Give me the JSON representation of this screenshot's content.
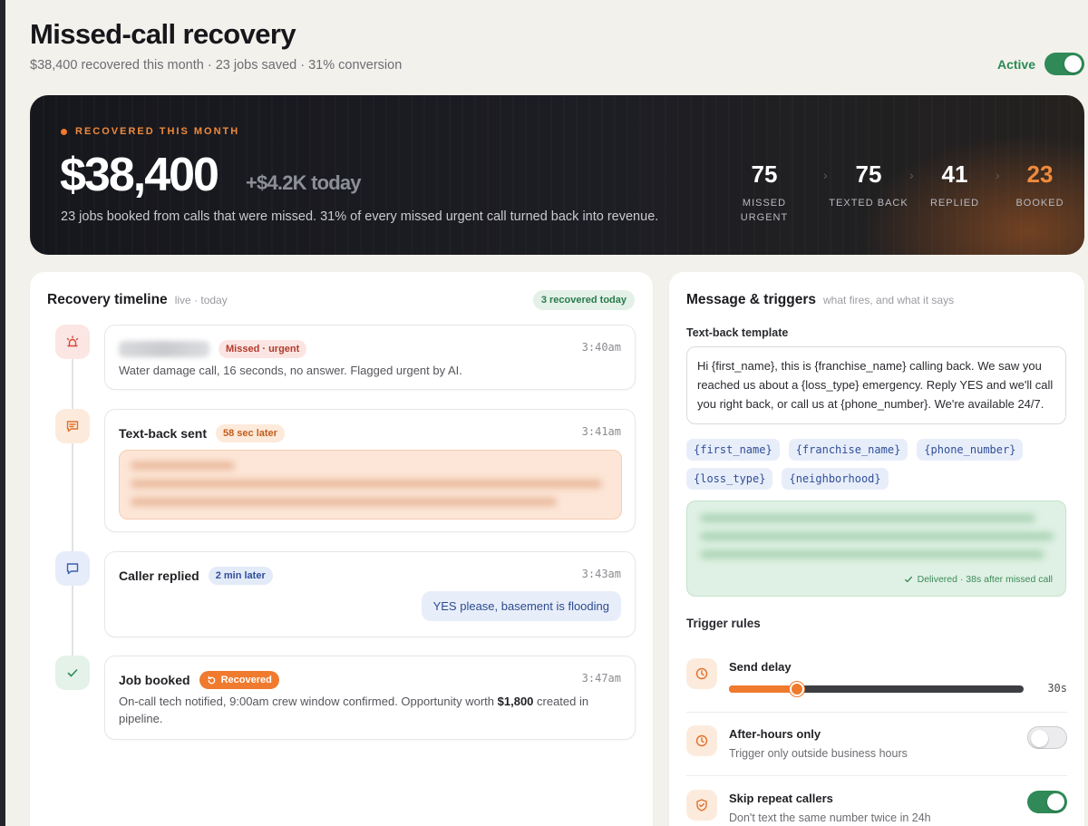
{
  "header": {
    "title": "Missed-call recovery",
    "subtitle": "$38,400 recovered this month · 23 jobs saved · 31% conversion",
    "active_label": "Active",
    "active_on": true
  },
  "hero": {
    "eyebrow": "RECOVERED THIS MONTH",
    "amount": "$38,400",
    "today": "+$4.2K today",
    "description": "23 jobs booked from calls that were missed. 31% of every missed urgent call turned back into revenue.",
    "funnel": [
      {
        "value": "75",
        "label": "MISSED URGENT"
      },
      {
        "value": "75",
        "label": "TEXTED BACK"
      },
      {
        "value": "41",
        "label": "REPLIED"
      },
      {
        "value": "23",
        "label": "BOOKED"
      }
    ]
  },
  "timeline": {
    "title": "Recovery timeline",
    "subtitle": "live · today",
    "summary_badge": "3 recovered today",
    "events": [
      {
        "badge": "Missed · urgent",
        "time": "3:40am",
        "body": "Water damage call, 16 seconds, no answer. Flagged urgent by AI."
      },
      {
        "title": "Text-back sent",
        "badge": "58 sec later",
        "time": "3:41am"
      },
      {
        "title": "Caller replied",
        "badge": "2 min later",
        "time": "3:43am",
        "reply": "YES please, basement is flooding"
      },
      {
        "title": "Job booked",
        "badge": "Recovered",
        "time": "3:47am",
        "body_pre": "On-call tech notified, 9:00am crew window confirmed. Opportunity worth ",
        "body_amount": "$1,800",
        "body_post": " created in pipeline."
      }
    ]
  },
  "messages": {
    "title": "Message & triggers",
    "subtitle": "what fires, and what it says",
    "template_label": "Text-back template",
    "template_text": "Hi {first_name}, this is {franchise_name} calling back. We saw you reached us about a {loss_type} emergency. Reply YES and we'll call you right back, or call us at {phone_number}. We're available 24/7.",
    "chips": [
      "{first_name}",
      "{franchise_name}",
      "{phone_number}",
      "{loss_type}",
      "{neighborhood}"
    ],
    "delivered": "Delivered · 38s after missed call",
    "rules_label": "Trigger rules",
    "rules": [
      {
        "title": "Send delay",
        "value_label": "30s",
        "slider_fraction": 0.23
      },
      {
        "title": "After-hours only",
        "desc": "Trigger only outside business hours",
        "enabled": false
      },
      {
        "title": "Skip repeat callers",
        "desc": "Don't text the same number twice in 24h",
        "enabled": true
      }
    ]
  },
  "colors": {
    "accent": "#f07a2e",
    "success": "#2f8a57",
    "chip_blue": "#2f4f9a"
  }
}
